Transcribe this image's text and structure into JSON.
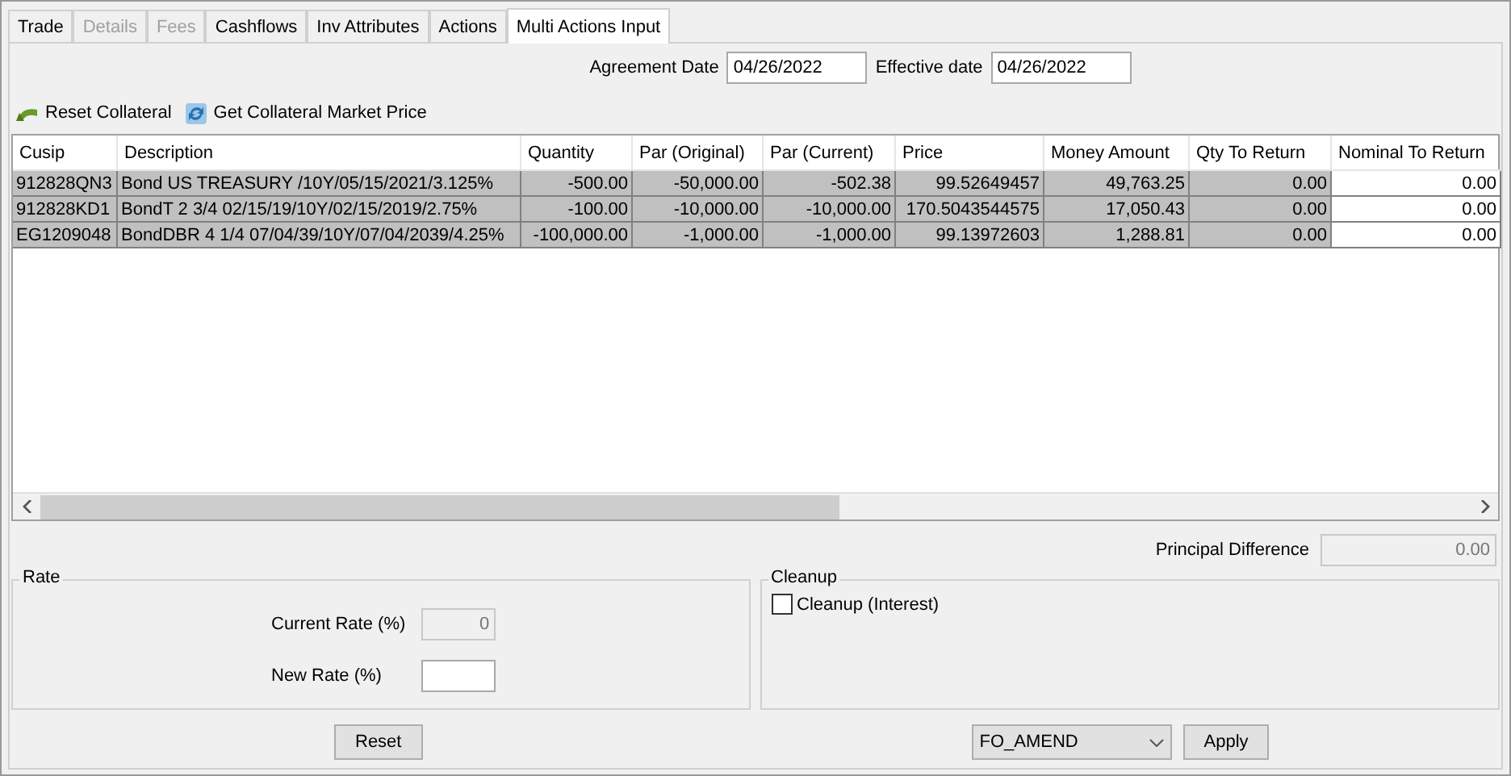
{
  "tabs": [
    {
      "label": "Trade",
      "selected": false,
      "disabled": false
    },
    {
      "label": "Details",
      "selected": false,
      "disabled": true
    },
    {
      "label": "Fees",
      "selected": false,
      "disabled": true
    },
    {
      "label": "Cashflows",
      "selected": false,
      "disabled": false
    },
    {
      "label": "Inv Attributes",
      "selected": false,
      "disabled": false
    },
    {
      "label": "Actions",
      "selected": false,
      "disabled": false
    },
    {
      "label": "Multi Actions Input",
      "selected": true,
      "disabled": false
    }
  ],
  "dates": [
    {
      "label": "Agreement Date",
      "value": "04/26/2022"
    },
    {
      "label": "Effective date",
      "value": "04/26/2022"
    }
  ],
  "toolbar": [
    {
      "kind": "reset",
      "label": "Reset Collateral"
    },
    {
      "kind": "refresh",
      "label": "Get Collateral Market Price"
    }
  ],
  "table": {
    "columns": [
      {
        "label": "Cusip",
        "kind": "text",
        "editable": false
      },
      {
        "label": "Description",
        "kind": "text",
        "editable": false
      },
      {
        "label": "Quantity",
        "kind": "number",
        "editable": false
      },
      {
        "label": "Par (Original)",
        "kind": "number",
        "editable": false
      },
      {
        "label": "Par (Current)",
        "kind": "number",
        "editable": false
      },
      {
        "label": "Price",
        "kind": "number",
        "editable": false
      },
      {
        "label": "Money Amount",
        "kind": "number",
        "editable": false
      },
      {
        "label": "Qty To Return",
        "kind": "number",
        "editable": false
      },
      {
        "label": "Nominal To Return",
        "kind": "number",
        "editable": true
      }
    ],
    "rows": [
      [
        "912828QN3",
        "Bond US TREASURY /10Y/05/15/2021/3.125%",
        "-500.00",
        "-50,000.00",
        "-502.38",
        "99.52649457",
        "49,763.25",
        "0.00",
        "0.00"
      ],
      [
        "912828KD1",
        "BondT 2 3/4 02/15/19/10Y/02/15/2019/2.75%",
        "-100.00",
        "-10,000.00",
        "-10,000.00",
        "170.5043544575",
        "17,050.43",
        "0.00",
        "0.00"
      ],
      [
        "EG1209048",
        "BondDBR 4 1/4 07/04/39/10Y/07/04/2039/4.25%",
        "-100,000.00",
        "-1,000.00",
        "-1,000.00",
        "99.13972603",
        "1,288.81",
        "0.00",
        "0.00"
      ]
    ]
  },
  "principal_difference": {
    "label": "Principal Difference",
    "value": "0.00"
  },
  "rate": {
    "title": "Rate",
    "current_label": "Current Rate (%)",
    "current_value": "0",
    "new_label": "New Rate (%)"
  },
  "cleanup": {
    "title": "Cleanup",
    "option": {
      "label": "Cleanup (Interest)",
      "checked": false
    }
  },
  "reset_button": "Reset",
  "action_select": "FO_AMEND",
  "apply_button": "Apply"
}
